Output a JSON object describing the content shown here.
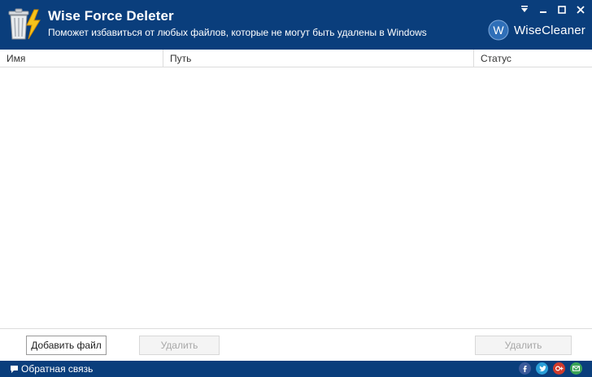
{
  "header": {
    "title": "Wise Force Deleter",
    "subtitle": "Поможет избавиться от любых файлов, которые не могут быть удалены в Windows",
    "brand": "WiseCleaner",
    "brand_logo_letter": "W",
    "background_color": "#0a3e7c"
  },
  "window_controls": [
    "menu-icon",
    "minimize-icon",
    "maximize-icon",
    "close-icon"
  ],
  "columns": {
    "name": "Имя",
    "path": "Путь",
    "status": "Статус"
  },
  "files": [],
  "toolbar": {
    "add_file_label": "Добавить файл",
    "delete_label": "Удалить",
    "delete_all_label": "Удалить"
  },
  "statusbar": {
    "feedback_label": "Обратная связь",
    "social_icons": [
      "facebook-icon",
      "twitter-icon",
      "google-plus-icon",
      "email-icon"
    ]
  }
}
